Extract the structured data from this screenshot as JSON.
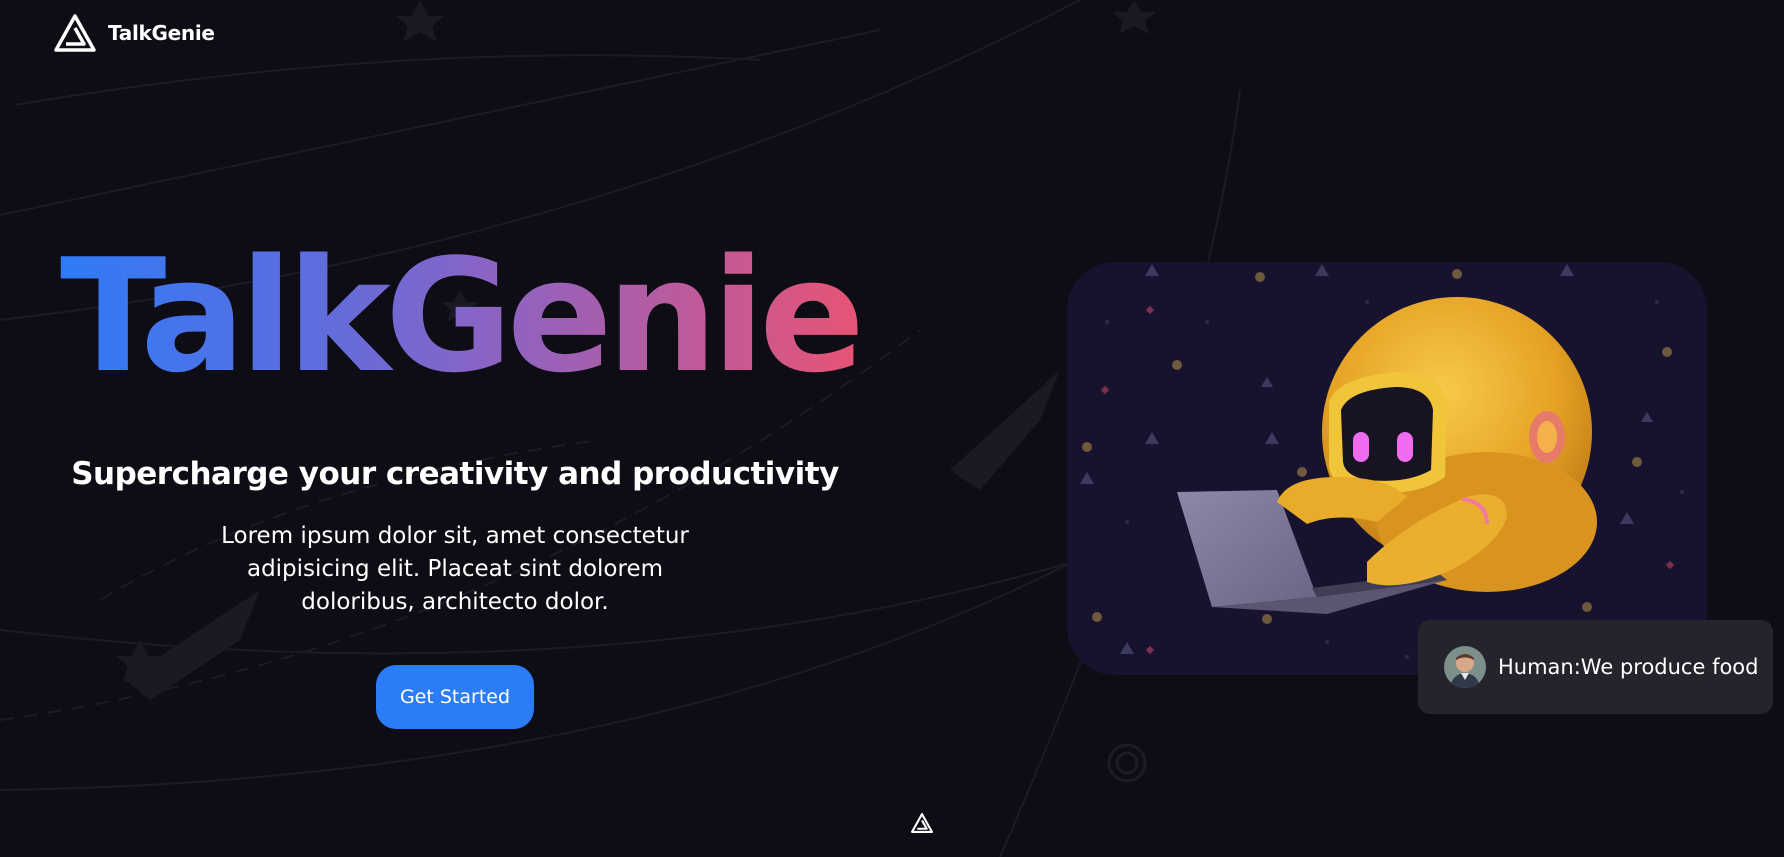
{
  "header": {
    "brand_name": "TalkGenie",
    "logo_icon": "triangle-logo-icon"
  },
  "hero": {
    "title": "TalkGenie",
    "subtitle": "Supercharge your creativity and productivity",
    "description": "Lorem ipsum dolor sit, amet consectetur adipisicing elit. Placeat sint dolorem doloribus, architecto dolor.",
    "cta_label": "Get Started",
    "image_icon": "robot-with-laptop-illustration"
  },
  "chat_card": {
    "avatar_icon": "user-avatar-icon",
    "text": "Human:We produce food"
  },
  "footer": {
    "icon": "triangle-logo-icon"
  },
  "colors": {
    "background": "#0e0c15",
    "accent": "#2a7cf7",
    "gradient_start": "#2f7bf7",
    "gradient_end": "#e75474",
    "card_background": "#25242c",
    "image_background": "#17132e",
    "robot": "#e9a82a"
  }
}
